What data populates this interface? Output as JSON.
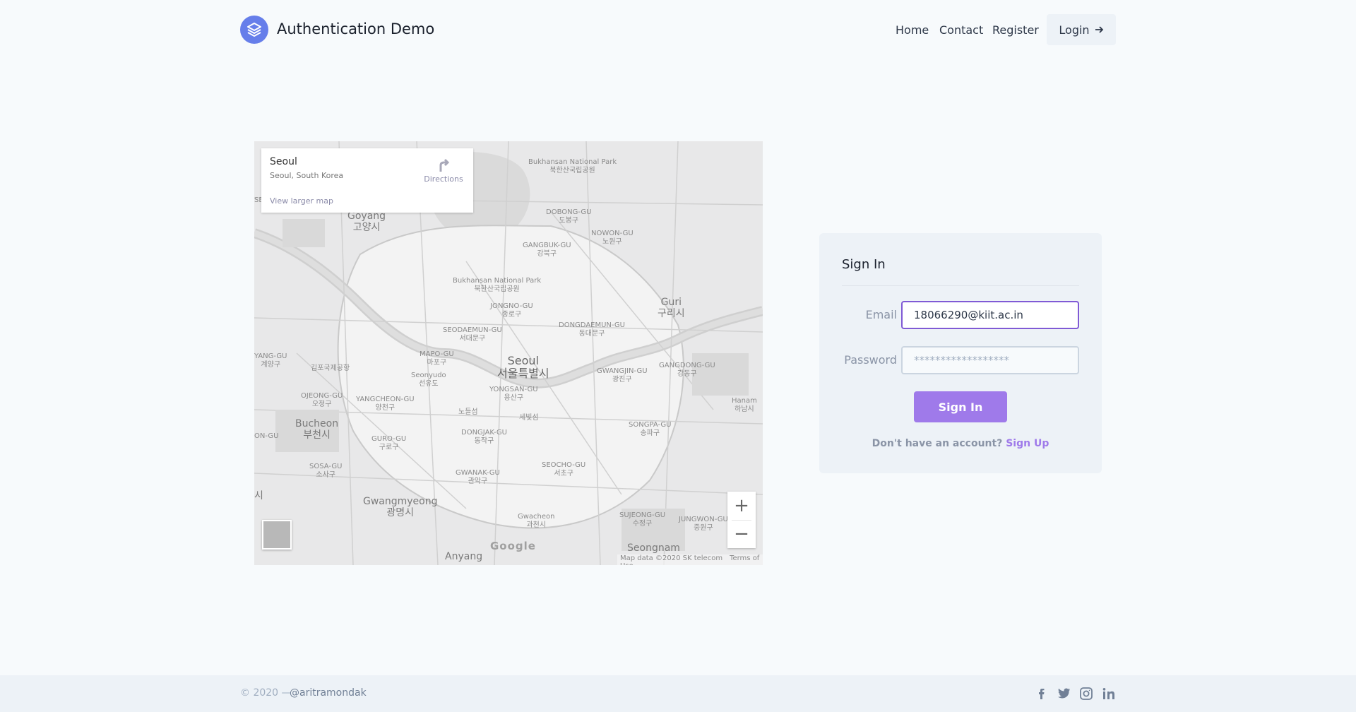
{
  "header": {
    "brand": "Authentication Demo",
    "nav": [
      "Home",
      "Contact",
      "Register"
    ],
    "login_label": "Login"
  },
  "map": {
    "place_name": "Seoul",
    "place_address": "Seoul, South Korea",
    "directions_label": "Directions",
    "larger_map_label": "View larger map",
    "logo_text": "Google",
    "map_data": "Map data ©2020 SK telecom",
    "terms": "Terms of Use",
    "zoom_in": "+",
    "zoom_out": "−",
    "labels": {
      "park1": "Bukhansan National Park",
      "park1_ko": "북한산국립공원",
      "goyang": "Goyang",
      "goyang_ko": "고양시",
      "dobong": "DOBONG-GU",
      "dobong_ko": "도봉구",
      "nowon": "NOWON-GU",
      "nowon_ko": "노원구",
      "gangbuk": "GANGBUK-GU",
      "gangbuk_ko": "강북구",
      "park2": "Bukhansan National Park",
      "park2_ko": "북한산국립공원",
      "guri": "Guri",
      "guri_ko": "구리시",
      "jongno": "JONGNO-GU",
      "jongno_ko": "종로구",
      "seodaemun": "SEODAEMUN-GU",
      "seodaemun_ko": "서대문구",
      "dongdaemun": "DONGDAEMUN-GU",
      "dongdaemun_ko": "동대문구",
      "mapo": "MAPO-GU",
      "mapo_ko": "마포구",
      "seoul": "Seoul",
      "seoul_ko": "서울특별시",
      "yangcheon_left": "YANG-GU",
      "yangcheon_left_ko": "계양구",
      "gimpo": "김포국제공항",
      "seonyudo": "Seonyudo",
      "seonyudo_ko": "선유도",
      "gwangjin": "GWANGJIN-GU",
      "gwangjin_ko": "광진구",
      "gangdong": "GANGDONG-GU",
      "gangdong_ko": "강동구",
      "hanam": "Hanam",
      "hanam_ko": "하남시",
      "ojeong": "OJEONG-GU",
      "ojeong_ko": "오정구",
      "yangcheon": "YANGCHEON-GU",
      "yangcheon_ko": "양천구",
      "yongsan": "YONGSAN-GU",
      "yongsan_ko": "용산구",
      "nodeulseom": "노들섬",
      "sebitseom": "세빛섬",
      "songpa": "SONGPA-GU",
      "songpa_ko": "송파구",
      "bucheon": "Bucheon",
      "bucheon_ko": "부천시",
      "guro": "GURO-GU",
      "guro_ko": "구로구",
      "dongjak": "DONGJAK-GU",
      "dongjak_ko": "동작구",
      "wongu": "ON-GU",
      "sosa": "SOSA-GU",
      "sosa_ko": "소사구",
      "gwanak": "GWANAK-GU",
      "gwanak_ko": "관악구",
      "seocho": "SEOCHO-GU",
      "seocho_ko": "서초구",
      "gwangmyeong": "Gwangmyeong",
      "gwangmyeong_ko": "광명시",
      "gwacheon": "Gwacheon",
      "gwacheon_ko": "과천시",
      "sujeong": "SUJEONG-GU",
      "sujeong_ko": "수정구",
      "jungwon": "JUNGWON-GU",
      "jungwon_ko": "중원구",
      "seongnam": "Seongnam",
      "anyang": "Anyang",
      "edge_si": "시",
      "edge_se": "SE"
    }
  },
  "signin": {
    "title": "Sign In",
    "email_label": "Email",
    "email_value": "18066290@kiit.ac.in",
    "password_label": "Password",
    "password_placeholder": "******************",
    "button": "Sign In",
    "no_account": "Don't have an account?",
    "signup_link": "Sign Up"
  },
  "footer": {
    "copyright": "© 2020 —",
    "handle": "@aritramondak",
    "social_icons": [
      "facebook-icon",
      "twitter-icon",
      "instagram-icon",
      "linkedin-icon"
    ]
  },
  "colors": {
    "accent": "#9f7aea",
    "logo": "#667eea",
    "background": "#f7fafc",
    "card": "#edf2f7"
  }
}
